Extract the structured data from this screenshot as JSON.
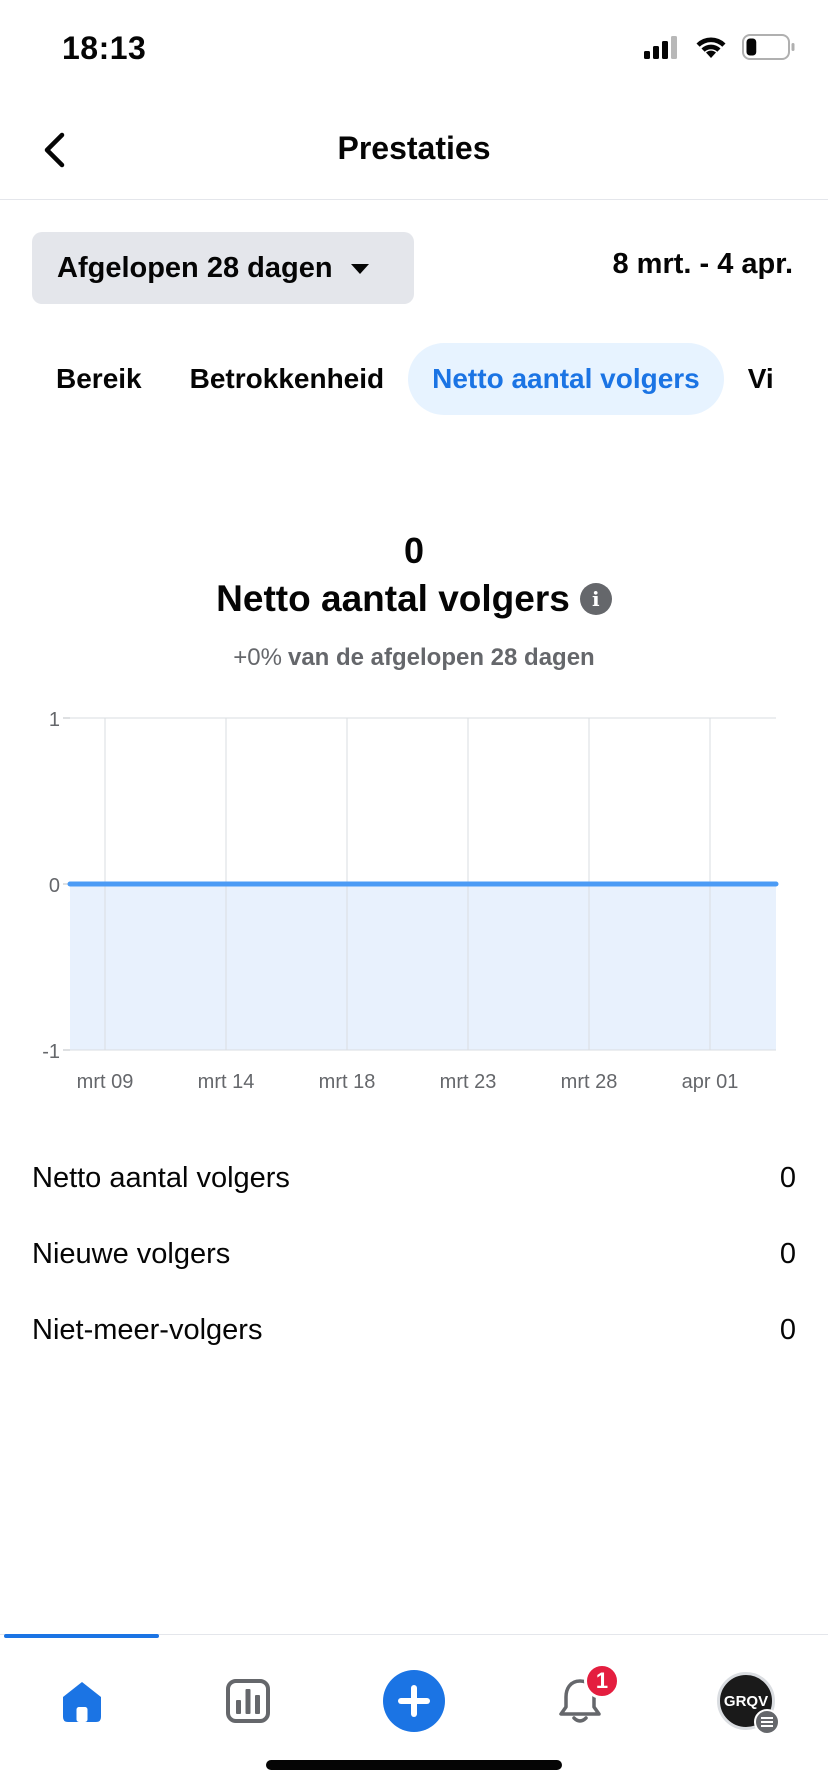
{
  "status_bar": {
    "time": "18:13",
    "battery_level": 0.25
  },
  "nav": {
    "title": "Prestaties",
    "back_icon": "chevron-left-icon"
  },
  "filter": {
    "range_label": "Afgelopen 28 dagen",
    "date_range": "8 mrt. - 4 apr."
  },
  "tabs": [
    {
      "label": "Bereik",
      "active": false
    },
    {
      "label": "Betrokkenheid",
      "active": false
    },
    {
      "label": "Netto aantal volgers",
      "active": true
    },
    {
      "label": "Vi",
      "active": false
    }
  ],
  "summary": {
    "value": "0",
    "title": "Netto aantal volgers",
    "change": "+0%",
    "change_label": "van de afgelopen 28 dagen"
  },
  "chart_data": {
    "type": "area",
    "x": [
      "mrt 09",
      "mrt 14",
      "mrt 18",
      "mrt 23",
      "mrt 28",
      "apr 01"
    ],
    "values": [
      0,
      0,
      0,
      0,
      0,
      0
    ],
    "yticks": [
      "1",
      "0",
      "-1"
    ],
    "ylim": [
      -1,
      1
    ],
    "grid": true,
    "line_color": "#4b9bf5",
    "fill_color": "#e8f1fd",
    "title": "",
    "xlabel": "",
    "ylabel": ""
  },
  "metrics": [
    {
      "label": "Netto aantal volgers",
      "value": "0"
    },
    {
      "label": "Nieuwe volgers",
      "value": "0"
    },
    {
      "label": "Niet-meer-volgers",
      "value": "0"
    }
  ],
  "bottom_nav": {
    "items": [
      "home-icon",
      "insights-icon",
      "create-icon",
      "notifications-icon",
      "profile-avatar"
    ],
    "notification_count": "1",
    "avatar_text": "GRQV",
    "accent": "#1b74e4"
  }
}
